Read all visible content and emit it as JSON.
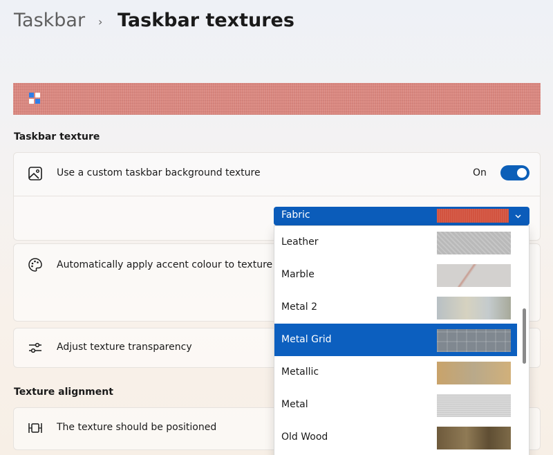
{
  "breadcrumb": {
    "parent": "Taskbar",
    "separator": "›",
    "current": "Taskbar textures"
  },
  "sections": {
    "texture": "Taskbar texture",
    "alignment": "Texture alignment"
  },
  "rows": {
    "custom_texture": {
      "label": "Use a custom taskbar background texture",
      "state": "On",
      "enabled": true
    },
    "accent": {
      "label": "Automatically apply accent colour to texture"
    },
    "transparency": {
      "label": "Adjust texture transparency"
    },
    "position": {
      "label": "The texture should be positioned"
    }
  },
  "texture_select": {
    "value": "Fabric",
    "options": [
      "Leather",
      "Marble",
      "Metal 2",
      "Metal Grid",
      "Metallic",
      "Metal",
      "Old Wood"
    ],
    "selected": "Metal Grid"
  },
  "colors": {
    "accent": "#0c5fbf",
    "preview": "#d9877f",
    "fabric": "#d2533f"
  },
  "icons": {
    "image": "image-icon",
    "palette": "palette-icon",
    "sliders": "sliders-icon",
    "align": "align-center-icon",
    "chevron": "chevron-down-icon",
    "start": "start-menu-icon"
  }
}
